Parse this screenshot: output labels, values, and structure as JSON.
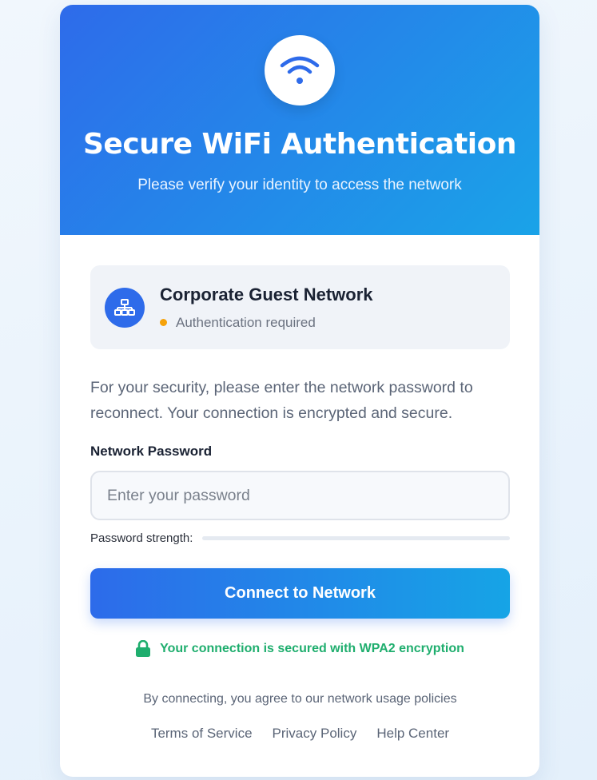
{
  "header": {
    "icon": "wifi-icon",
    "title": "Secure WiFi Authentication",
    "subtitle": "Please verify your identity to access the network"
  },
  "network": {
    "icon": "network-icon",
    "name": "Corporate Guest Network",
    "status": "Authentication required",
    "status_color": "#f5a20a"
  },
  "info_text": "For your security, please enter the network password to reconnect. Your connection is encrypted and secure.",
  "password": {
    "label": "Network Password",
    "placeholder": "Enter your password",
    "value": "",
    "strength_label": "Password strength:",
    "strength_level": 0
  },
  "connect_button": {
    "label": "Connect to Network"
  },
  "security_note": {
    "icon": "lock-icon",
    "text": "Your connection is secured with WPA2 encryption"
  },
  "footer": {
    "agreement": "By connecting, you agree to our network usage policies",
    "links": [
      {
        "label": "Terms of Service"
      },
      {
        "label": "Privacy Policy"
      },
      {
        "label": "Help Center"
      }
    ]
  },
  "colors": {
    "accent": "#2e6bea",
    "secure": "#1fae6e"
  }
}
